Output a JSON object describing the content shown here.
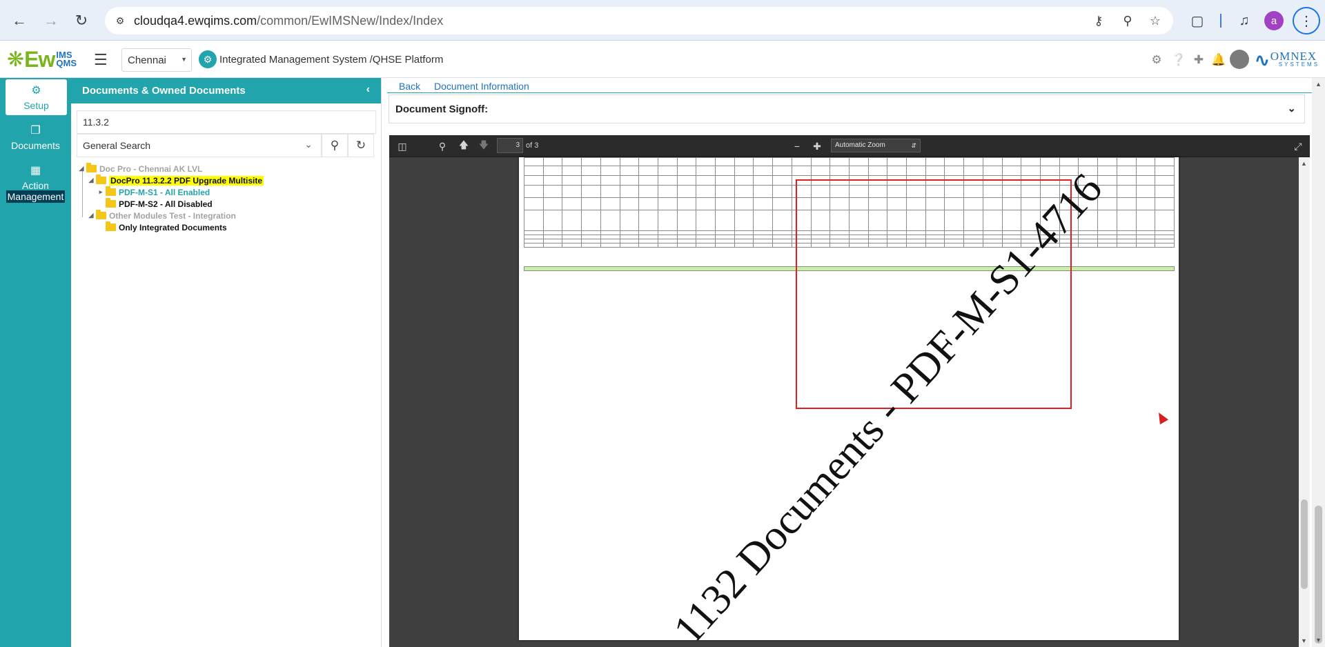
{
  "browser": {
    "url_host": "cloudqa4.ewqims.com",
    "url_path": "/common/EwIMSNew/Index/Index",
    "profile_initial": "a"
  },
  "header": {
    "logo_main": "Ew",
    "logo_top": "IMS",
    "logo_bottom": "QMS",
    "location": "Chennai",
    "platform_title": "Integrated Management System /QHSE Platform",
    "brand_main": "OMNEX",
    "brand_sub": "SYSTEMS"
  },
  "left_nav": {
    "items": [
      {
        "label": "Setup"
      },
      {
        "label": "Documents"
      },
      {
        "label_line1": "Action",
        "label_line2": "Management"
      }
    ]
  },
  "doc_panel": {
    "title": "Documents & Owned Documents",
    "search_value": "11.3.2",
    "search_type": "General Search",
    "tree": [
      {
        "label": "Doc Pro - Chennai AK LVL"
      },
      {
        "label": "DocPro 11.3.2.2 PDF Upgrade Multisite"
      },
      {
        "label": "PDF-M-S1 - All Enabled"
      },
      {
        "label": "PDF-M-S2 - All Disabled"
      },
      {
        "label": "Other Modules Test - Integration"
      },
      {
        "label": "Only Integrated Documents"
      }
    ]
  },
  "main": {
    "back": "Back",
    "doc_info": "Document Information",
    "signoff_title": "Document Signoff:"
  },
  "pdf": {
    "page_number": "3",
    "page_of": "of 3",
    "zoom": "Automatic Zoom",
    "watermark": "1132 Documents - PDF-M-S1-4716"
  },
  "colors": {
    "teal": "#21a4ab",
    "highlight": "#ffff00",
    "red_box": "#e02020"
  }
}
